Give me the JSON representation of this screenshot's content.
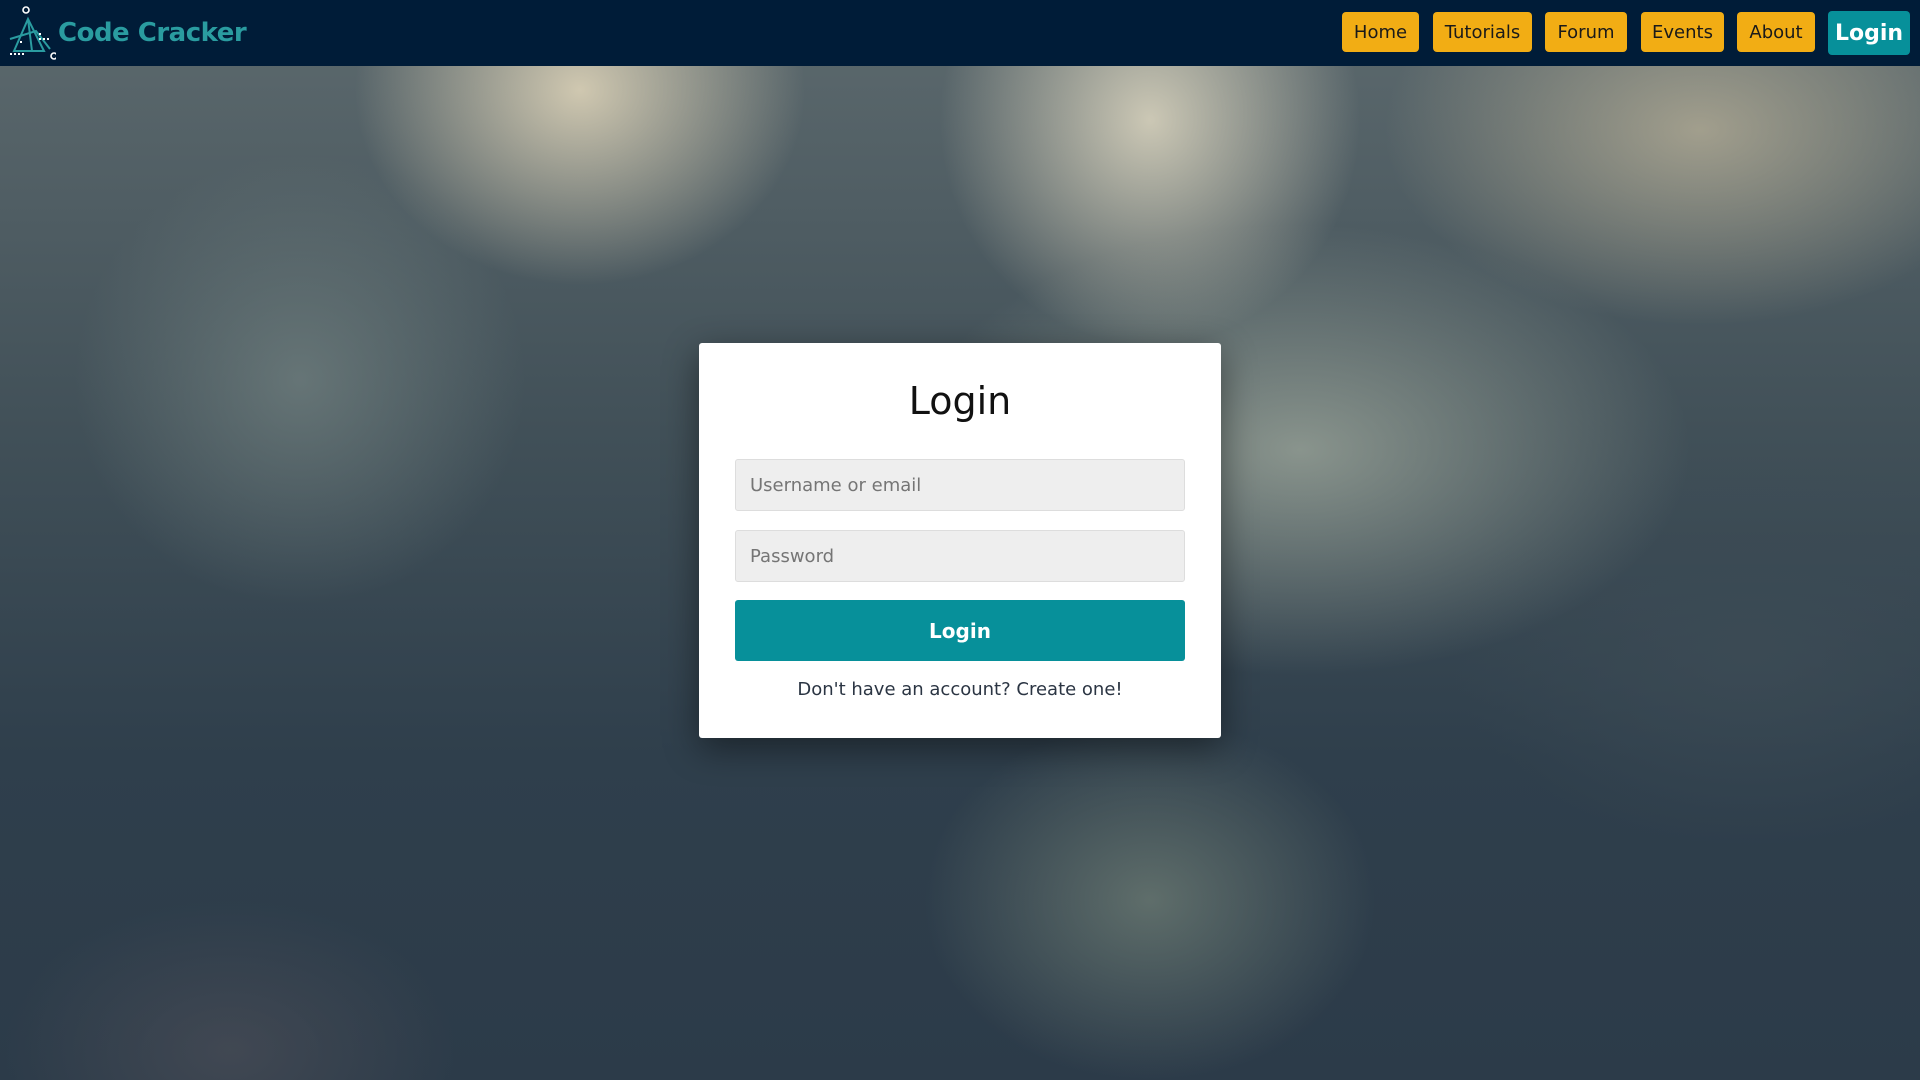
{
  "brand": {
    "name": "Code Cracker",
    "logo_icon": "code-cracker-logo-icon",
    "color": "#2a9ca0"
  },
  "nav": {
    "items": [
      {
        "label": "Home"
      },
      {
        "label": "Tutorials"
      },
      {
        "label": "Forum"
      },
      {
        "label": "Events"
      },
      {
        "label": "About"
      }
    ],
    "login_label": "Login",
    "button_color": "#f2ad14",
    "login_color": "#07909a",
    "bar_color": "#001c38"
  },
  "login_form": {
    "title": "Login",
    "username_placeholder": "Username or email",
    "username_value": "",
    "password_placeholder": "Password",
    "password_value": "",
    "submit_label": "Login",
    "signup_text": "Don't have an account? Create one!"
  }
}
